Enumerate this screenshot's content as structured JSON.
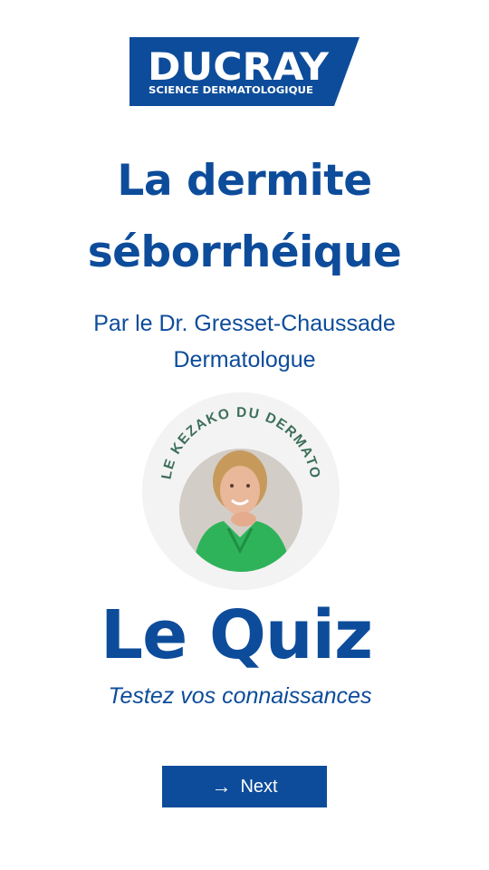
{
  "brand": {
    "name": "DUCRAY",
    "tagline": "SCIENCE DERMATOLOGIQUE",
    "color": "#0d4c9a"
  },
  "title": {
    "line1": "La dermite",
    "line2": "séborrhéique"
  },
  "author": {
    "line1": "Par le Dr. Gresset-Chaussade",
    "line2": "Dermatologue"
  },
  "badge": {
    "arc_text": "LE KEZAKO DU DERMATO",
    "ring_color": "#3c6f5a"
  },
  "quiz": {
    "heading": "Le Quiz",
    "subtitle": "Testez vos connaissances"
  },
  "next_button": {
    "icon": "arrow-right-icon",
    "label": "Next"
  }
}
